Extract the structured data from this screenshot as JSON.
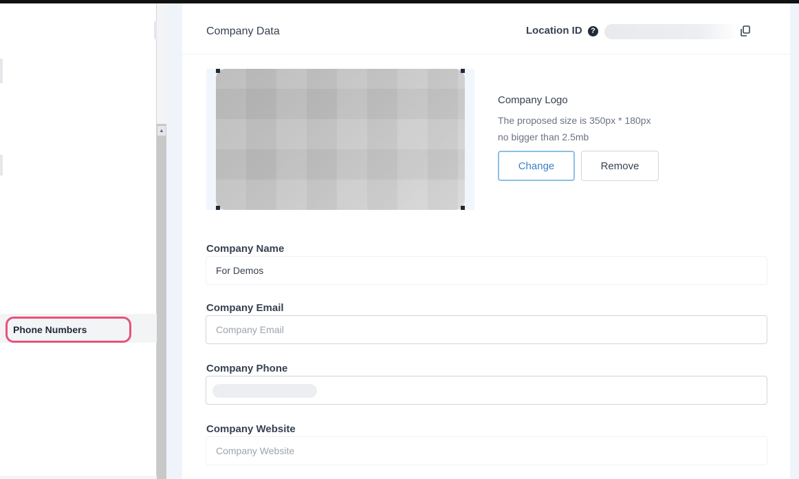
{
  "sidebar": {
    "active_item_label": "Phone Numbers"
  },
  "header": {
    "title": "Company Data",
    "location_label": "Location ID",
    "location_value": ""
  },
  "logo": {
    "heading": "Company Logo",
    "hint_size": "The proposed size is 350px * 180px",
    "hint_limit": "no bigger than 2.5mb",
    "change_label": "Change",
    "remove_label": "Remove"
  },
  "fields": {
    "name": {
      "label": "Company Name",
      "value": "For Demos",
      "placeholder": ""
    },
    "email": {
      "label": "Company Email",
      "value": "",
      "placeholder": "Company Email"
    },
    "phone": {
      "label": "Company Phone",
      "value": "",
      "placeholder": ""
    },
    "website": {
      "label": "Company Website",
      "value": "",
      "placeholder": "Company Website"
    }
  },
  "colors": {
    "accent": "#3b82c4",
    "highlight_ring": "#e8517a"
  },
  "icons": {
    "help": "question-circle-icon",
    "copy": "copy-icon"
  }
}
